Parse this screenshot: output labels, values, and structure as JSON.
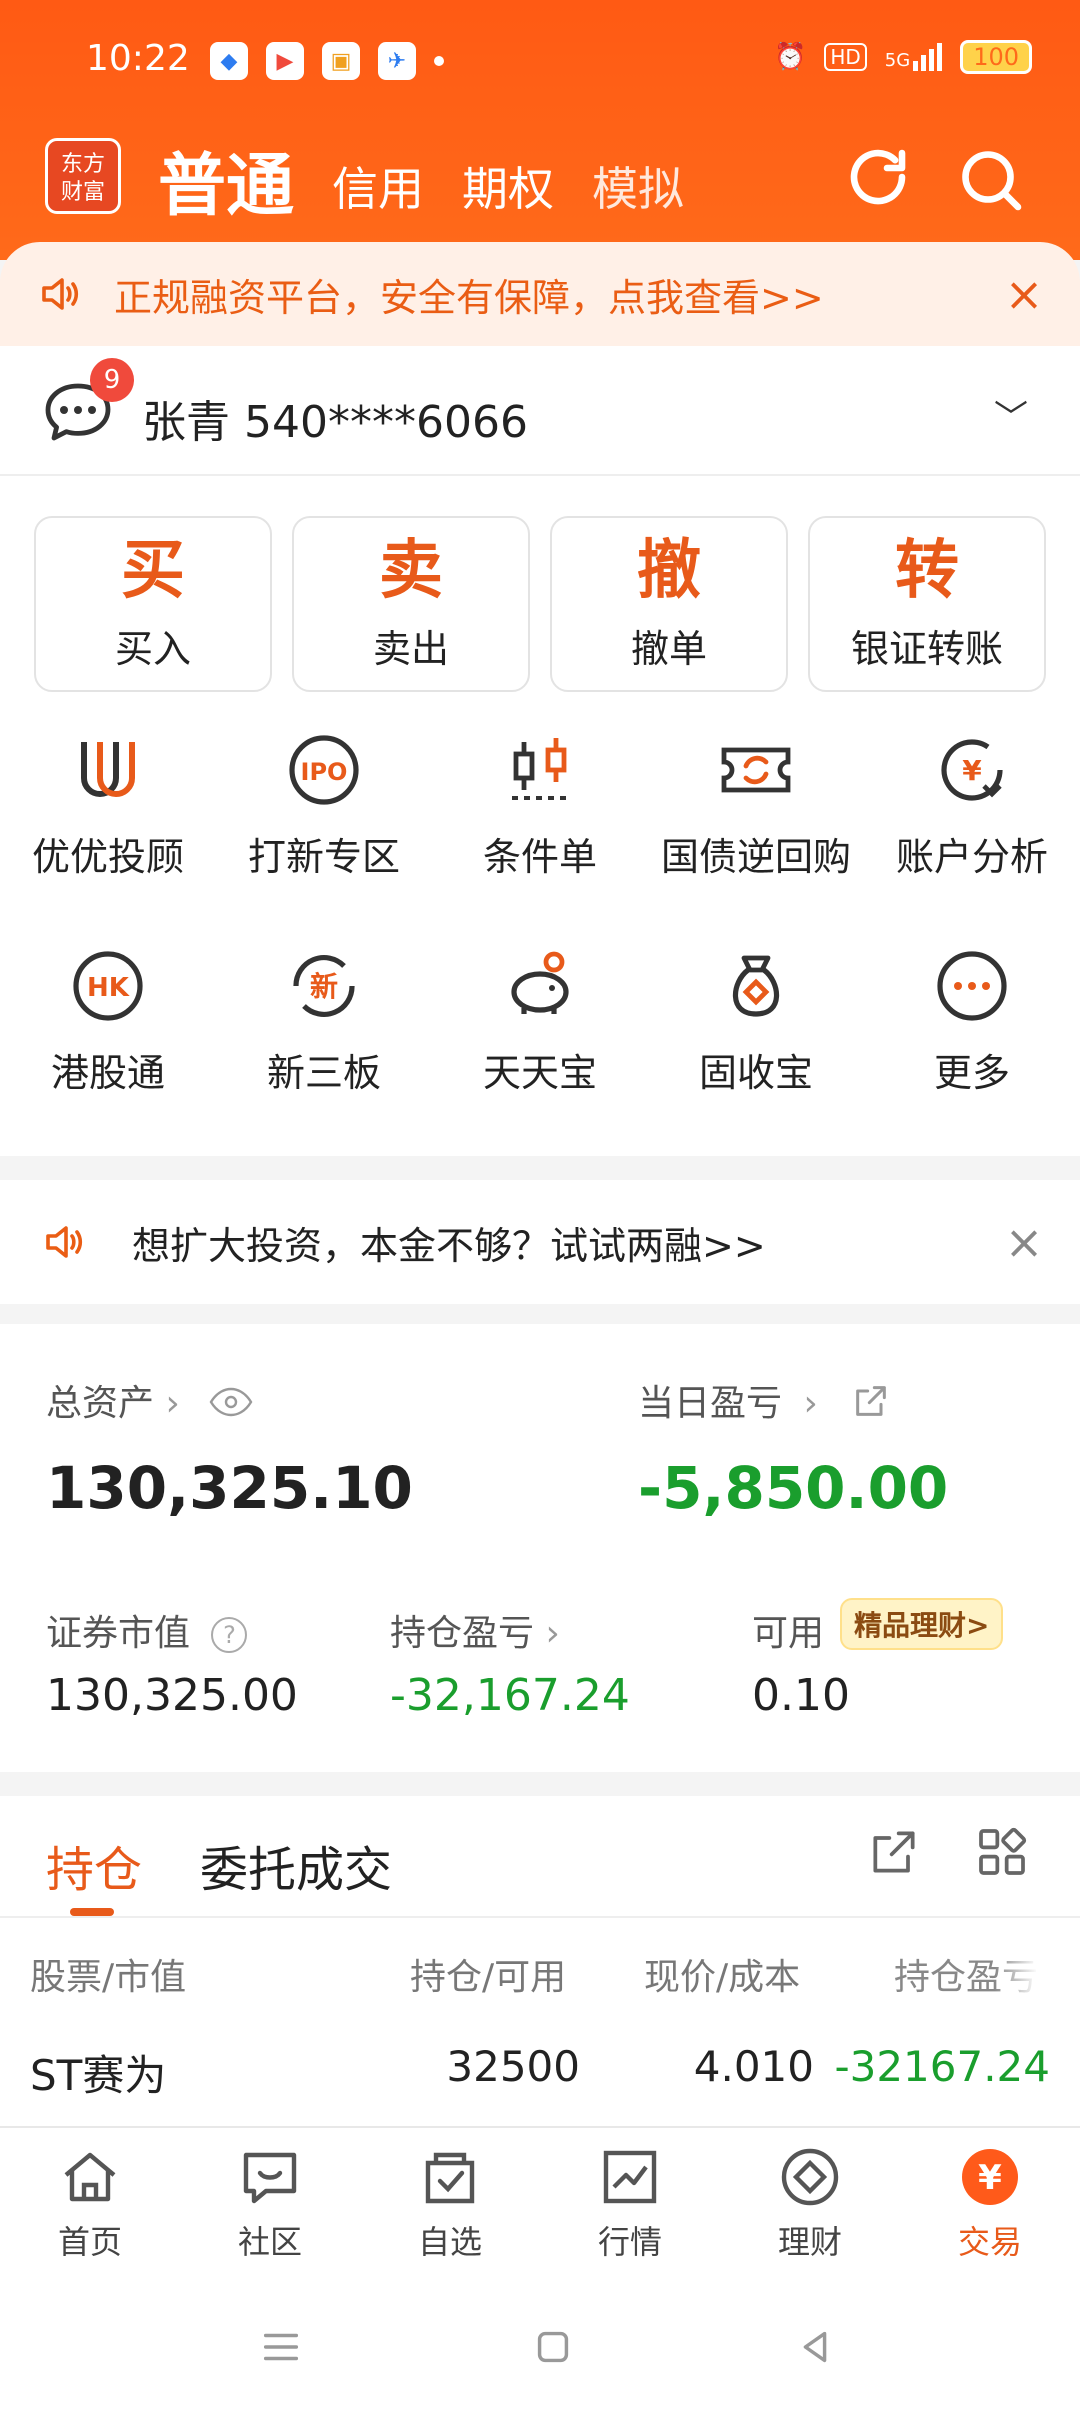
{
  "status_bar": {
    "time": "10:22",
    "signal": "5G",
    "hd": "HD",
    "battery": "100"
  },
  "header": {
    "logo_text": "东方\n财富",
    "tabs": [
      "普通",
      "信用",
      "期权",
      "模拟"
    ],
    "accent": "#ff5a14"
  },
  "banner_top": {
    "text": "正规融资平台，安全有保障，点我查看>>"
  },
  "account": {
    "unread": "9",
    "name": "张青 540****6066"
  },
  "quick_actions": [
    {
      "glyph": "买",
      "label": "买入"
    },
    {
      "glyph": "卖",
      "label": "卖出"
    },
    {
      "glyph": "撤",
      "label": "撤单"
    },
    {
      "glyph": "转",
      "label": "银证转账"
    }
  ],
  "features_row1": [
    "优优投顾",
    "打新专区",
    "条件单",
    "国债逆回购",
    "账户分析"
  ],
  "features_row2": [
    "港股通",
    "新三板",
    "天天宝",
    "固收宝",
    "更多"
  ],
  "feature_icon_text": {
    "ipo": "IPO",
    "yen": "¥",
    "hk": "HK",
    "new": "新"
  },
  "banner_mid": {
    "text": "想扩大投资，本金不够？试试两融>>"
  },
  "assets": {
    "total_label": "总资产",
    "total_value": "130,325.10",
    "day_pl_label": "当日盈亏",
    "day_pl_value": "-5,850.00",
    "market_value_label": "证券市值",
    "market_value": "130,325.00",
    "position_pl_label": "持仓盈亏",
    "position_pl": "-32,167.24",
    "available_label": "可用",
    "available": "0.10",
    "wealth_pill": "精品理财>"
  },
  "holdings": {
    "tab_active": "持仓",
    "tab_other": "委托成交",
    "columns": [
      "股票/市值",
      "持仓/可用",
      "现价/成本",
      "持仓盈亏"
    ],
    "rows": [
      {
        "name": "ST赛为",
        "qty": "32500",
        "price": "4.010",
        "pl": "-32167.24"
      }
    ]
  },
  "bottom_nav": [
    "首页",
    "社区",
    "自选",
    "行情",
    "理财",
    "交易"
  ],
  "bottom_nav_active_glyph": "¥"
}
